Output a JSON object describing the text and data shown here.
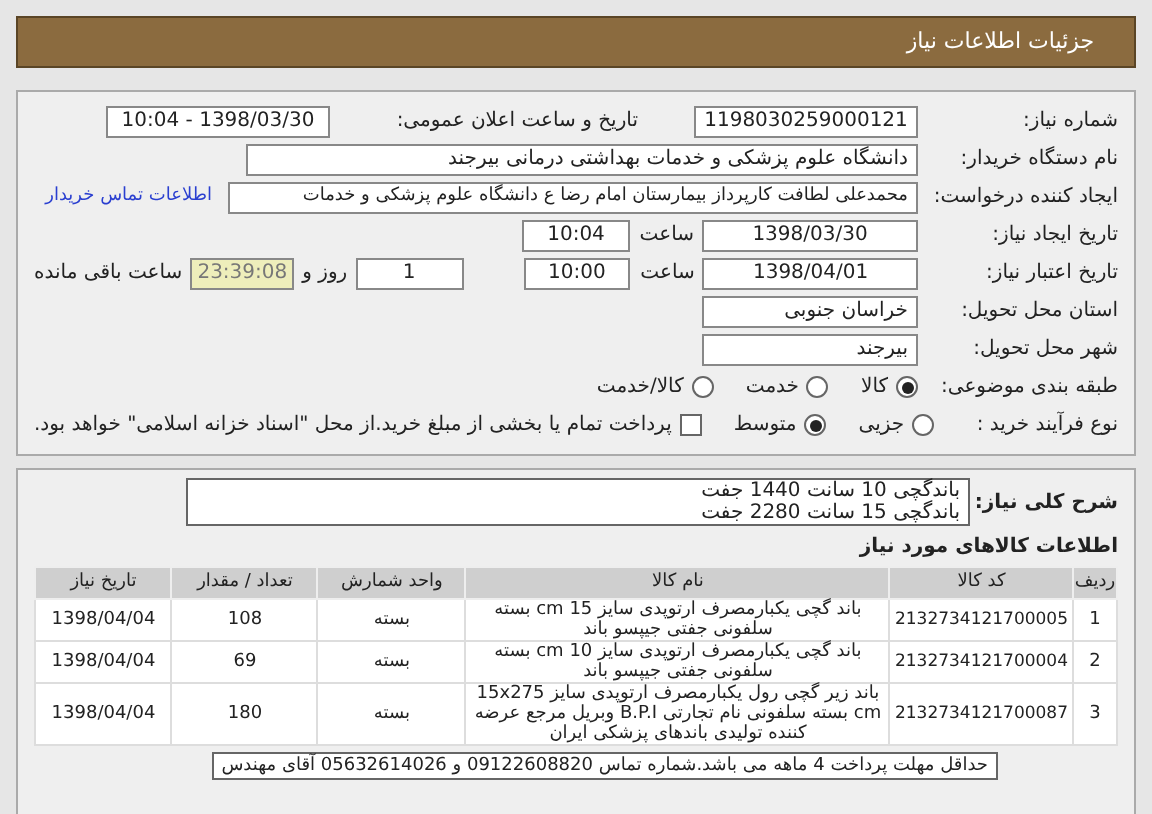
{
  "header": {
    "title": "جزئیات اطلاعات نیاز"
  },
  "form": {
    "need_number": {
      "label": "شماره نیاز:",
      "value": "1198030259000121"
    },
    "announce": {
      "label": "تاریخ و ساعت اعلان عمومی:",
      "value": "1398/03/30 - 10:04"
    },
    "buyer": {
      "label": "نام دستگاه خریدار:",
      "value": "دانشگاه علوم پزشکی و خدمات بهداشتی درمانی بیرجند"
    },
    "requester": {
      "label": "ایجاد کننده درخواست:",
      "value": "محمدعلی لطافت کارپرداز بیمارستان امام رضا ع دانشگاه علوم پزشکی و خدمات",
      "link": "اطلاعات تماس خریدار"
    },
    "created": {
      "label": "تاریخ ایجاد نیاز:",
      "date": "1398/03/30",
      "time_label": "ساعت",
      "time": "10:04"
    },
    "validity": {
      "label": "تاریخ اعتبار نیاز:",
      "date": "1398/04/01",
      "time_label": "ساعت",
      "time": "10:00",
      "days": "1",
      "days_label": "روز و",
      "remaining": "23:39:08",
      "remaining_label": "ساعت باقی مانده"
    },
    "province": {
      "label": "استان محل تحویل:",
      "value": "خراسان جنوبی"
    },
    "city": {
      "label": "شهر محل تحویل:",
      "value": "بیرجند"
    },
    "category": {
      "label": "طبقه بندی موضوعی:",
      "options": [
        {
          "label": "کالا",
          "selected": true
        },
        {
          "label": "خدمت",
          "selected": false
        },
        {
          "label": "کالا/خدمت",
          "selected": false
        }
      ]
    },
    "process": {
      "label": "نوع فرآیند خرید :",
      "options": [
        {
          "label": "جزیی",
          "selected": false
        },
        {
          "label": "متوسط",
          "selected": true
        }
      ],
      "treasury": {
        "checked": false,
        "label": "پرداخت تمام یا بخشی از مبلغ خرید.از محل \"اسناد خزانه اسلامی\" خواهد بود."
      }
    }
  },
  "description": {
    "label": "شرح کلی نیاز:",
    "lines": [
      "باندگچی 10 سانت 1440 جفت",
      "باندگچی 15 سانت 2280 جفت"
    ]
  },
  "goods": {
    "title": "اطلاعات کالاهای مورد نیاز",
    "columns": [
      "ردیف",
      "کد کالا",
      "نام کالا",
      "واحد شمارش",
      "تعداد / مقدار",
      "تاریخ نیاز"
    ],
    "rows": [
      [
        "1",
        "2132734121700005",
        "باند گچی یکبارمصرف ارتوپدی سایز 15 cm بسته سلفونی جفتی جیپسو باند",
        "بسته",
        "108",
        "1398/04/04"
      ],
      [
        "2",
        "2132734121700004",
        "باند گچی یکبارمصرف ارتوپدی سایز 10 cm بسته سلفونی جفتی جیپسو باند",
        "بسته",
        "69",
        "1398/04/04"
      ],
      [
        "3",
        "2132734121700087",
        "باند زیر گچی رول یکبارمصرف ارتوپدی سایز 15x275 cm بسته سلفونی نام تجارتی B.P.I وبریل مرجع عرضه کننده تولیدی باندهای پزشکی ایران",
        "بسته",
        "180",
        "1398/04/04"
      ]
    ]
  },
  "note": "حداقل مهلت پرداخت 4 ماهه می باشد.شماره تماس 09122608820 و 05632614026 آقای مهندس"
}
